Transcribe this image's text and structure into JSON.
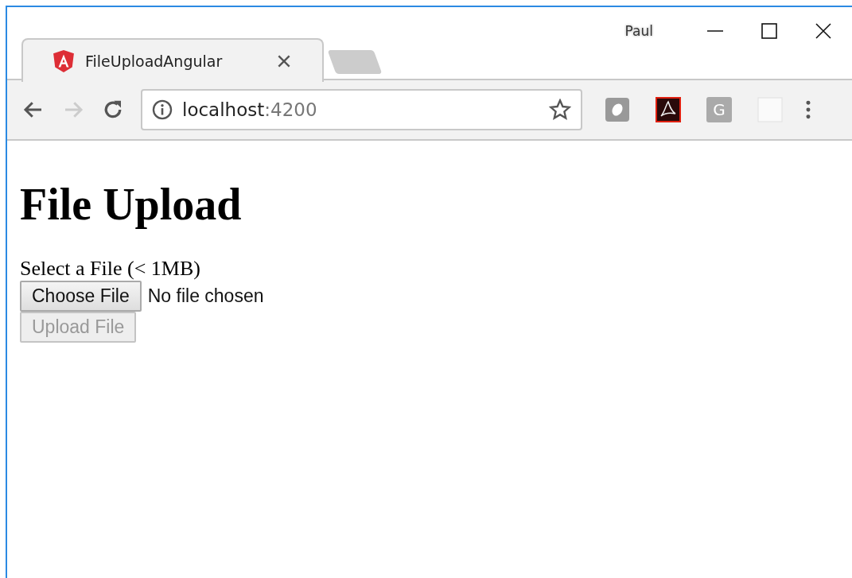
{
  "window": {
    "profile": "Paul"
  },
  "tabs": [
    {
      "title": "FileUploadAngular",
      "selected": true
    }
  ],
  "toolbar": {
    "back_disabled": false,
    "forward_disabled": true,
    "url_host": "localhost",
    "url_port": ":4200",
    "extensions": [
      {
        "kind": "blob"
      },
      {
        "kind": "pdf"
      },
      {
        "kind": "letter",
        "label": "G"
      },
      {
        "kind": "blank"
      }
    ]
  },
  "page": {
    "heading": "File Upload",
    "label": "Select a File (< 1MB)",
    "choose_button": "Choose File",
    "file_status": "No file chosen",
    "upload_button": {
      "label": "Upload File",
      "disabled": true
    }
  }
}
